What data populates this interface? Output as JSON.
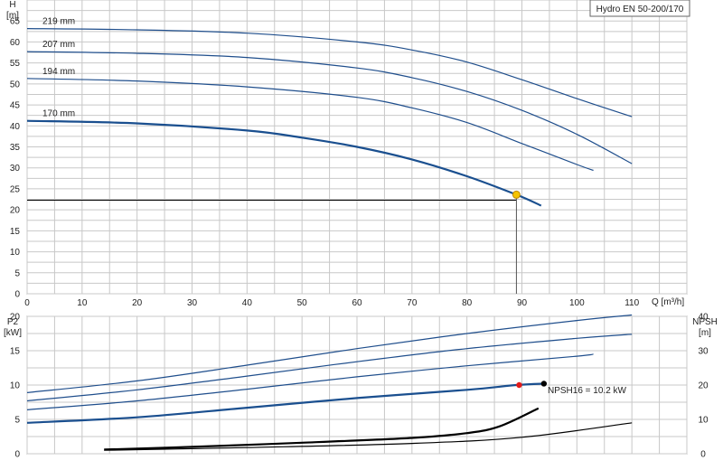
{
  "title": "Hydro EN 50-200/170",
  "colors": {
    "curve": "#1f4e8c",
    "grid": "#c8c8c8",
    "marker_yellow": "#f5c400",
    "marker_red": "#e31b1b",
    "marker_black": "#000000"
  },
  "chart_data": [
    {
      "type": "line",
      "name": "head",
      "ylabel_top": "H",
      "ylabel_unit": "[m]",
      "xlabel": "Q [m³/h]",
      "xlim": [
        0,
        120
      ],
      "ylim": [
        0,
        70
      ],
      "xticks": [
        0,
        10,
        20,
        30,
        40,
        50,
        60,
        70,
        80,
        90,
        100,
        110
      ],
      "yticks": [
        0,
        5,
        10,
        15,
        20,
        25,
        30,
        35,
        40,
        45,
        50,
        55,
        60,
        65
      ],
      "grid": true,
      "series": [
        {
          "name": "219 mm",
          "x": [
            0,
            20,
            40,
            60,
            70,
            80,
            90,
            100,
            110
          ],
          "y": [
            63.2,
            62.9,
            62.1,
            60.0,
            58.1,
            55.2,
            51.0,
            46.5,
            42.2
          ]
        },
        {
          "name": "207 mm",
          "x": [
            0,
            20,
            40,
            60,
            70,
            80,
            90,
            100,
            110
          ],
          "y": [
            57.7,
            57.3,
            56.3,
            53.8,
            51.5,
            48.2,
            43.7,
            38.0,
            31.0
          ]
        },
        {
          "name": "194 mm",
          "x": [
            0,
            20,
            40,
            60,
            70,
            80,
            90,
            100,
            103
          ],
          "y": [
            51.3,
            50.7,
            49.3,
            46.8,
            44.3,
            40.8,
            35.8,
            30.8,
            29.4
          ]
        },
        {
          "name": "170 mm",
          "x": [
            0,
            20,
            40,
            50,
            60,
            70,
            80,
            89,
            93.5
          ],
          "y": [
            41.2,
            40.6,
            38.9,
            37.2,
            35.0,
            32.0,
            28.0,
            23.6,
            21.0
          ],
          "highlight": true
        }
      ],
      "duty_point": {
        "x": 89,
        "y": 23.6,
        "h_line": 22.3
      }
    },
    {
      "type": "line",
      "name": "power_npsh",
      "ylabel_left_top": "P2",
      "ylabel_left_unit": "[kW]",
      "ylabel_right_top": "NPSH",
      "ylabel_right_unit": "[m]",
      "xlim": [
        0,
        120
      ],
      "ylim_left": [
        0,
        20
      ],
      "ylim_right": [
        0,
        40
      ],
      "yticks_left": [
        0,
        5,
        10,
        15,
        20
      ],
      "yticks_right": [
        0,
        10,
        20,
        30,
        40
      ],
      "annotation": "NPSH16 = 10.2 kW",
      "series": [
        {
          "name": "219 mm",
          "x": [
            0,
            20,
            40,
            60,
            80,
            100,
            110
          ],
          "y": [
            8.9,
            10.6,
            12.9,
            15.3,
            17.5,
            19.4,
            20.2
          ]
        },
        {
          "name": "207 mm",
          "x": [
            0,
            20,
            40,
            60,
            80,
            100,
            110
          ],
          "y": [
            7.7,
            9.3,
            11.3,
            13.4,
            15.3,
            16.8,
            17.4
          ]
        },
        {
          "name": "194 mm",
          "x": [
            0,
            20,
            40,
            60,
            80,
            100,
            103
          ],
          "y": [
            6.4,
            7.7,
            9.4,
            11.2,
            12.8,
            14.2,
            14.5
          ]
        },
        {
          "name": "170 mm",
          "x": [
            0,
            20,
            40,
            60,
            80,
            89,
            94
          ],
          "y": [
            4.5,
            5.3,
            6.7,
            8.1,
            9.3,
            10.0,
            10.2
          ],
          "highlight": true
        }
      ],
      "npsh_series": [
        {
          "x": [
            14,
            30,
            50,
            70,
            80,
            86,
            93
          ],
          "y": [
            0.6,
            1.0,
            1.6,
            2.3,
            3.0,
            4.0,
            6.6
          ],
          "highlight": true
        },
        {
          "x": [
            14,
            40,
            70,
            90,
            110
          ],
          "y": [
            0.5,
            0.9,
            1.5,
            2.4,
            4.5
          ]
        }
      ],
      "markers": [
        {
          "x": 89.5,
          "y": 10.0,
          "color": "red"
        },
        {
          "x": 94,
          "y": 10.2,
          "color": "black"
        }
      ]
    }
  ]
}
